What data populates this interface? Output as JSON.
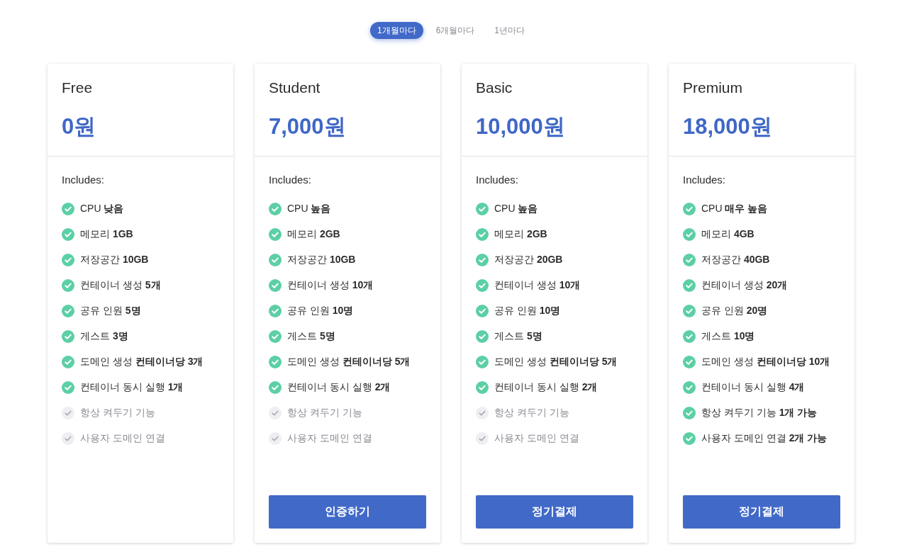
{
  "billing_tabs": [
    {
      "label": "1개월마다",
      "selected": true
    },
    {
      "label": "6개월마다",
      "selected": false
    },
    {
      "label": "1년마다",
      "selected": false
    }
  ],
  "plans": [
    {
      "name": "Free",
      "price": "0원",
      "includes_label": "Includes:",
      "features": [
        {
          "text": "CPU **낮음**",
          "included": true
        },
        {
          "text": "메모리 **1GB**",
          "included": true
        },
        {
          "text": "저장공간 **10GB**",
          "included": true
        },
        {
          "text": "컨테이너 생성 **5개**",
          "included": true
        },
        {
          "text": "공유 인원 **5명**",
          "included": true
        },
        {
          "text": "게스트 **3명**",
          "included": true
        },
        {
          "text": "도메인 생성 **컨테이너당 3개**",
          "included": true
        },
        {
          "text": "컨테이너 동시 실행 **1개**",
          "included": true
        },
        {
          "text": "항상 켜두기 기능",
          "included": false
        },
        {
          "text": "사용자 도메인 연결",
          "included": false
        }
      ]
    },
    {
      "name": "Student",
      "price": "7,000원",
      "includes_label": "Includes:",
      "features": [
        {
          "text": "CPU **높음**",
          "included": true
        },
        {
          "text": "메모리 **2GB**",
          "included": true
        },
        {
          "text": "저장공간 **10GB**",
          "included": true
        },
        {
          "text": "컨테이너 생성 **10개**",
          "included": true
        },
        {
          "text": "공유 인원 **10명**",
          "included": true
        },
        {
          "text": "게스트 **5명**",
          "included": true
        },
        {
          "text": "도메인 생성 **컨테이너당 5개**",
          "included": true
        },
        {
          "text": "컨테이너 동시 실행 **2개**",
          "included": true
        },
        {
          "text": "항상 켜두기 기능",
          "included": false
        },
        {
          "text": "사용자 도메인 연결",
          "included": false
        }
      ],
      "button": "인증하기"
    },
    {
      "name": "Basic",
      "price": "10,000원",
      "includes_label": "Includes:",
      "features": [
        {
          "text": "CPU **높음**",
          "included": true
        },
        {
          "text": "메모리 **2GB**",
          "included": true
        },
        {
          "text": "저장공간 **20GB**",
          "included": true
        },
        {
          "text": "컨테이너 생성 **10개**",
          "included": true
        },
        {
          "text": "공유 인원 **10명**",
          "included": true
        },
        {
          "text": "게스트 **5명**",
          "included": true
        },
        {
          "text": "도메인 생성 **컨테이너당 5개**",
          "included": true
        },
        {
          "text": "컨테이너 동시 실행 **2개**",
          "included": true
        },
        {
          "text": "항상 켜두기 기능",
          "included": false
        },
        {
          "text": "사용자 도메인 연결",
          "included": false
        }
      ],
      "button": "정기결제"
    },
    {
      "name": "Premium",
      "price": "18,000원",
      "includes_label": "Includes:",
      "features": [
        {
          "text": "CPU **매우 높음**",
          "included": true
        },
        {
          "text": "메모리 **4GB**",
          "included": true
        },
        {
          "text": "저장공간 **40GB**",
          "included": true
        },
        {
          "text": "컨테이너 생성 **20개**",
          "included": true
        },
        {
          "text": "공유 인원 **20명**",
          "included": true
        },
        {
          "text": "게스트 **10명**",
          "included": true
        },
        {
          "text": "도메인 생성 **컨테이너당 10개**",
          "included": true
        },
        {
          "text": "컨테이너 동시 실행 **4개**",
          "included": true
        },
        {
          "text": "항상 켜두기 기능 **1개 가능**",
          "included": true
        },
        {
          "text": "사용자 도메인 연결 **2개 가능**",
          "included": true
        }
      ],
      "button": "정기결제"
    }
  ]
}
